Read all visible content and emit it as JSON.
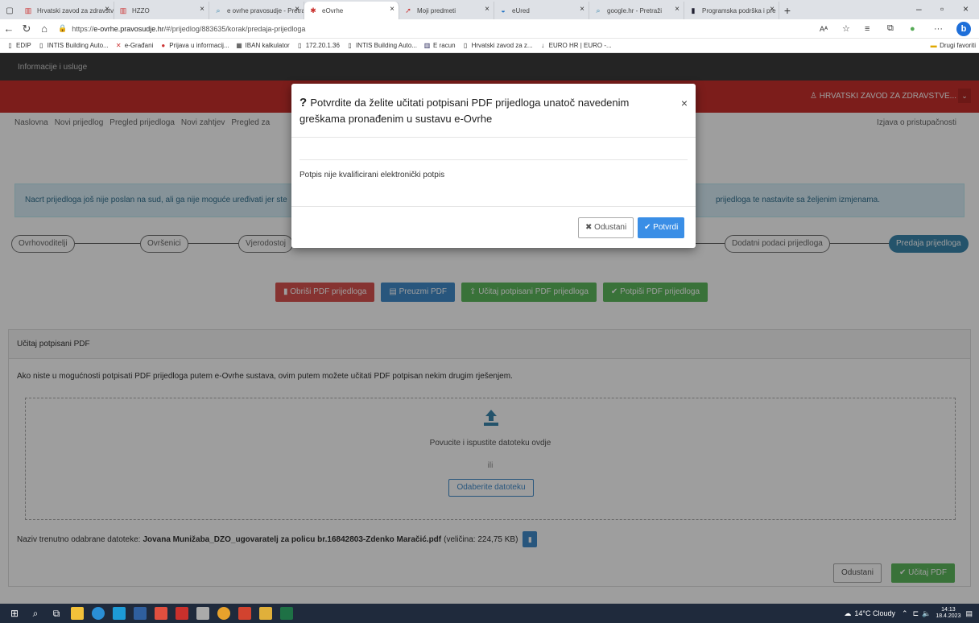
{
  "browser": {
    "tabs": [
      {
        "label": "Hrvatski zavod za zdravstv",
        "icon": "hzzo-icon",
        "active": false
      },
      {
        "label": "HZZO",
        "icon": "hzzo-icon",
        "active": false
      },
      {
        "label": "e ovrhe pravosudje - Pretra",
        "icon": "search-icon",
        "active": false
      },
      {
        "label": "eOvrhe",
        "icon": "eovrhe-icon",
        "active": true
      },
      {
        "label": "Moji predmeti",
        "icon": "pin-icon",
        "active": false
      },
      {
        "label": "eUred",
        "icon": "eured-icon",
        "active": false
      },
      {
        "label": "google.hr - Pretraži",
        "icon": "search-icon",
        "active": false
      },
      {
        "label": "Programska podrška i pre",
        "icon": "app-icon",
        "active": false
      }
    ],
    "url_prefix": "https://",
    "url_host": "e-ovrhe.pravosudje.hr",
    "url_path": "/#/prijedlog/883635/korak/predaja-prijedloga",
    "favorites": [
      {
        "label": "EDIP",
        "icon": "page-icon"
      },
      {
        "label": "INTIS Building Auto...",
        "icon": "page-icon"
      },
      {
        "label": "e-Građani",
        "icon": "egradani-icon"
      },
      {
        "label": "Prijava u informacij...",
        "icon": "red-circle-icon"
      },
      {
        "label": "IBAN kalkulator",
        "icon": "iban-icon"
      },
      {
        "label": "172.20.1.36",
        "icon": "page-icon"
      },
      {
        "label": "INTIS Building Auto...",
        "icon": "page-icon"
      },
      {
        "label": "E racun",
        "icon": "eracun-icon"
      },
      {
        "label": "Hrvatski zavod za z...",
        "icon": "page-icon"
      },
      {
        "label": "EURO HR | EURO -...",
        "icon": "euro-icon"
      }
    ],
    "other_favorites": "Drugi favoriti"
  },
  "app": {
    "top_left": "Informacije i usluge",
    "user": "HRVATSKI ZAVOD ZA ZDRAVSTVE...",
    "nav": [
      "Naslovna",
      "Novi prijedlog",
      "Pregled prijedloga",
      "Novi zahtjev",
      "Pregled za"
    ],
    "nav_right": "Izjava o pristupačnosti",
    "alert_left": "Nacrt prijedloga još nije poslan na sud, ali ga nije moguće uređivati jer ste",
    "alert_right": "prijedloga te nastavite sa željenim izmjenama.",
    "steps": [
      "Ovrhovoditelji",
      "Ovršenici",
      "Vjerodostoj",
      "Dodatni podaci prijedloga",
      "Predaja prijedloga"
    ],
    "actions": {
      "delete": "Obriši PDF prijedloga",
      "download": "Preuzmi PDF",
      "upload_signed": "Učitaj potpisani PDF prijedloga",
      "sign": "Potpiši PDF prijedloga"
    },
    "panel": {
      "title": "Učitaj potpisani PDF",
      "description": "Ako niste u mogućnosti potpisati PDF prijedloga putem e-Ovrhe sustava, ovim putem možete učitati PDF potpisan nekim drugim rješenjem.",
      "drop_text": "Povucite i ispustite datoteku ovdje",
      "or": "ili",
      "choose_file": "Odaberite datoteku",
      "filename_label": "Naziv trenutno odabrane datoteke:",
      "filename": "Jovana Munižaba_DZO_ugovaratelj za policu br.16842803-Zdenko Maračić.pdf",
      "filesize": "(veličina: 224,75 KB)",
      "cancel": "Odustani",
      "upload": "Učitaj PDF"
    }
  },
  "modal": {
    "title": "Potvrdite da želite učitati potpisani PDF prijedloga unatoč navedenim greškama pronađenim u sustavu e-Ovrhe",
    "message": "Potpis nije kvalificirani elektronički potpis",
    "cancel": "Odustani",
    "confirm": "Potvrdi"
  },
  "taskbar": {
    "weather": "14°C  Cloudy",
    "time": "14:13",
    "date": "18.4.2023"
  },
  "colors": {
    "header_red": "#c9302c",
    "primary_blue": "#428bca",
    "success_green": "#5cb85c",
    "danger_red": "#d9534f",
    "confirm_blue": "#3a8ee6"
  }
}
